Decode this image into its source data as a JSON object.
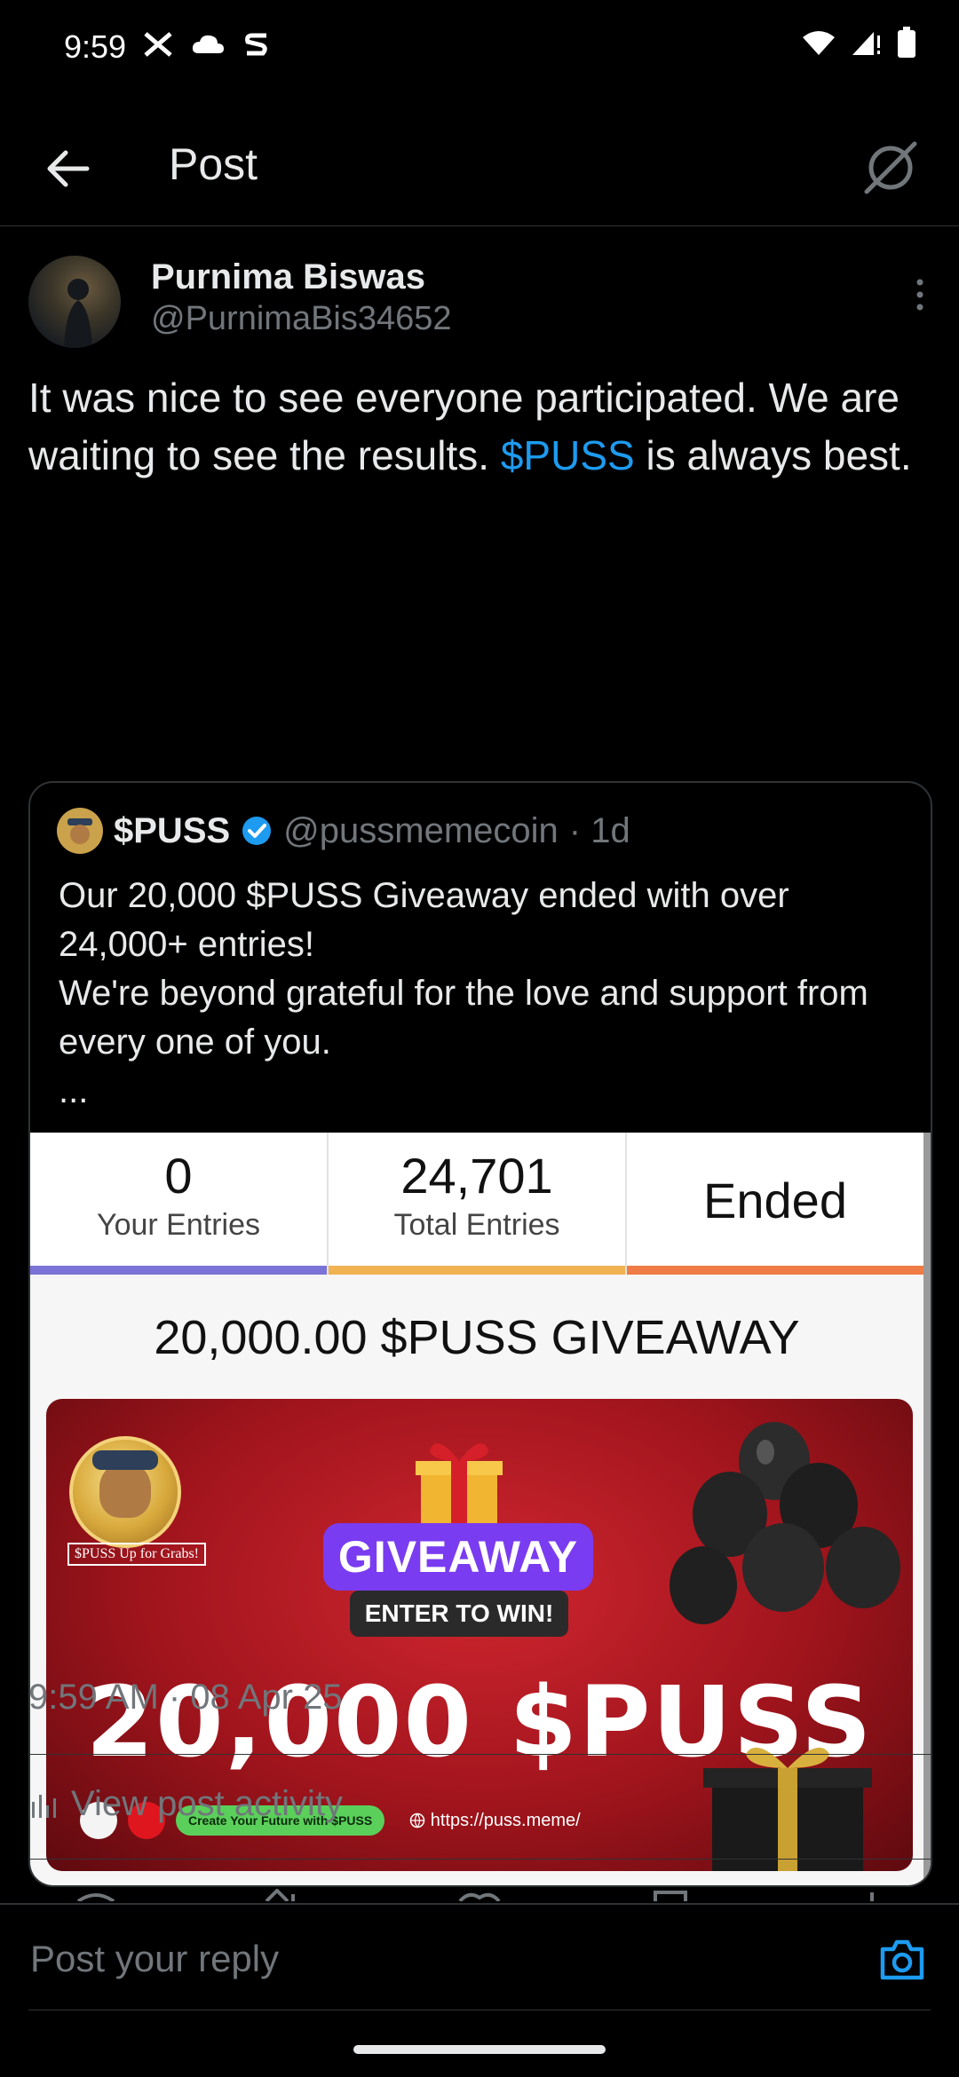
{
  "status_bar": {
    "time": "9:59"
  },
  "header": {
    "title": "Post"
  },
  "post": {
    "author_name": "Purnima Biswas",
    "author_handle": "@PurnimaBis34652",
    "text_part1": "It was nice to see everyone participated. We are waiting to see the results. ",
    "cashtag": "$PUSS",
    "text_part2": " is always best.",
    "timestamp": "9:59 AM · 08 Apr 25",
    "view_activity": "View post activity"
  },
  "quote": {
    "name": "$PUSS",
    "handle": "@pussmemecoin",
    "age": " · 1d",
    "text": "Our 20,000 $PUSS Giveaway ended with over 24,000+ entries!\nWe're beyond grateful for the love and support from every one of you.\n...",
    "card": {
      "stats": [
        {
          "value": "0",
          "label": "Your Entries",
          "color": "#7b73d6"
        },
        {
          "value": "24,701",
          "label": "Total Entries",
          "color": "#f1b252"
        },
        {
          "value": "Ended",
          "label": "",
          "color": "#ef7b45"
        }
      ],
      "title": "20,000.00 $PUSS GIVEAWAY",
      "banner": {
        "badge": "$PUSS Up for Grabs!",
        "pill": "GIVEAWAY",
        "subpill": "ENTER TO WIN!",
        "headline": "20,000 $PUSS",
        "chip": "Create Your Future with $PUSS",
        "url": "https://puss.meme/"
      }
    }
  },
  "reply": {
    "placeholder": "Post your reply"
  },
  "colors": {
    "link": "#1d9bf0",
    "verified": "#1d9bf0",
    "muted": "#71767b"
  }
}
